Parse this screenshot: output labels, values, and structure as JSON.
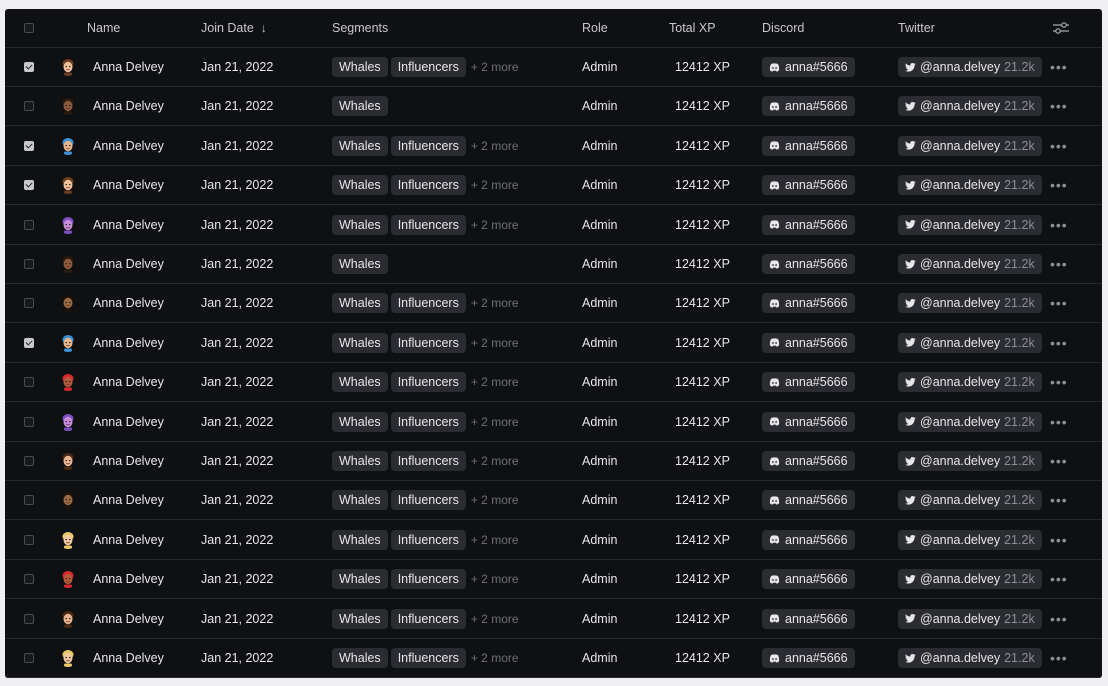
{
  "header": {
    "name": "Name",
    "join_date": "Join Date",
    "sort_glyph": "↓",
    "segments": "Segments",
    "role": "Role",
    "total_xp": "Total XP",
    "discord": "Discord",
    "twitter": "Twitter"
  },
  "rows": [
    {
      "checked": true,
      "avatar": "avatar-1",
      "name": "Anna Delvey",
      "join_date": "Jan 21, 2022",
      "segments": [
        "Whales",
        "Influencers"
      ],
      "more": "+ 2 more",
      "role": "Admin",
      "xp": "12412 XP",
      "discord": "anna#5666",
      "twitter": "@anna.delvey",
      "followers": "21.2k"
    },
    {
      "checked": false,
      "avatar": "avatar-2",
      "name": "Anna Delvey",
      "join_date": "Jan 21, 2022",
      "segments": [
        "Whales"
      ],
      "more": "",
      "role": "Admin",
      "xp": "12412 XP",
      "discord": "anna#5666",
      "twitter": "@anna.delvey",
      "followers": "21.2k"
    },
    {
      "checked": true,
      "avatar": "avatar-3",
      "name": "Anna Delvey",
      "join_date": "Jan 21, 2022",
      "segments": [
        "Whales",
        "Influencers"
      ],
      "more": "+ 2 more",
      "role": "Admin",
      "xp": "12412 XP",
      "discord": "anna#5666",
      "twitter": "@anna.delvey",
      "followers": "21.2k"
    },
    {
      "checked": true,
      "avatar": "avatar-1",
      "name": "Anna Delvey",
      "join_date": "Jan 21, 2022",
      "segments": [
        "Whales",
        "Influencers"
      ],
      "more": "+ 2 more",
      "role": "Admin",
      "xp": "12412 XP",
      "discord": "anna#5666",
      "twitter": "@anna.delvey",
      "followers": "21.2k"
    },
    {
      "checked": false,
      "avatar": "avatar-4",
      "name": "Anna Delvey",
      "join_date": "Jan 21, 2022",
      "segments": [
        "Whales",
        "Influencers"
      ],
      "more": "+ 2 more",
      "role": "Admin",
      "xp": "12412 XP",
      "discord": "anna#5666",
      "twitter": "@anna.delvey",
      "followers": "21.2k"
    },
    {
      "checked": false,
      "avatar": "avatar-2",
      "name": "Anna Delvey",
      "join_date": "Jan 21, 2022",
      "segments": [
        "Whales"
      ],
      "more": "",
      "role": "Admin",
      "xp": "12412 XP",
      "discord": "anna#5666",
      "twitter": "@anna.delvey",
      "followers": "21.2k"
    },
    {
      "checked": false,
      "avatar": "avatar-5",
      "name": "Anna Delvey",
      "join_date": "Jan 21, 2022",
      "segments": [
        "Whales",
        "Influencers"
      ],
      "more": "+ 2 more",
      "role": "Admin",
      "xp": "12412 XP",
      "discord": "anna#5666",
      "twitter": "@anna.delvey",
      "followers": "21.2k"
    },
    {
      "checked": true,
      "avatar": "avatar-3",
      "name": "Anna Delvey",
      "join_date": "Jan 21, 2022",
      "segments": [
        "Whales",
        "Influencers"
      ],
      "more": "+ 2 more",
      "role": "Admin",
      "xp": "12412 XP",
      "discord": "anna#5666",
      "twitter": "@anna.delvey",
      "followers": "21.2k"
    },
    {
      "checked": false,
      "avatar": "avatar-6",
      "name": "Anna Delvey",
      "join_date": "Jan 21, 2022",
      "segments": [
        "Whales",
        "Influencers"
      ],
      "more": "+ 2 more",
      "role": "Admin",
      "xp": "12412 XP",
      "discord": "anna#5666",
      "twitter": "@anna.delvey",
      "followers": "21.2k"
    },
    {
      "checked": false,
      "avatar": "avatar-4",
      "name": "Anna Delvey",
      "join_date": "Jan 21, 2022",
      "segments": [
        "Whales",
        "Influencers"
      ],
      "more": "+ 2 more",
      "role": "Admin",
      "xp": "12412 XP",
      "discord": "anna#5666",
      "twitter": "@anna.delvey",
      "followers": "21.2k"
    },
    {
      "checked": false,
      "avatar": "avatar-7",
      "name": "Anna Delvey",
      "join_date": "Jan 21, 2022",
      "segments": [
        "Whales",
        "Influencers"
      ],
      "more": "+ 2 more",
      "role": "Admin",
      "xp": "12412 XP",
      "discord": "anna#5666",
      "twitter": "@anna.delvey",
      "followers": "21.2k"
    },
    {
      "checked": false,
      "avatar": "avatar-5",
      "name": "Anna Delvey",
      "join_date": "Jan 21, 2022",
      "segments": [
        "Whales",
        "Influencers"
      ],
      "more": "+ 2 more",
      "role": "Admin",
      "xp": "12412 XP",
      "discord": "anna#5666",
      "twitter": "@anna.delvey",
      "followers": "21.2k"
    },
    {
      "checked": false,
      "avatar": "avatar-8",
      "name": "Anna Delvey",
      "join_date": "Jan 21, 2022",
      "segments": [
        "Whales",
        "Influencers"
      ],
      "more": "+ 2 more",
      "role": "Admin",
      "xp": "12412 XP",
      "discord": "anna#5666",
      "twitter": "@anna.delvey",
      "followers": "21.2k"
    },
    {
      "checked": false,
      "avatar": "avatar-6",
      "name": "Anna Delvey",
      "join_date": "Jan 21, 2022",
      "segments": [
        "Whales",
        "Influencers"
      ],
      "more": "+ 2 more",
      "role": "Admin",
      "xp": "12412 XP",
      "discord": "anna#5666",
      "twitter": "@anna.delvey",
      "followers": "21.2k"
    },
    {
      "checked": false,
      "avatar": "avatar-7",
      "name": "Anna Delvey",
      "join_date": "Jan 21, 2022",
      "segments": [
        "Whales",
        "Influencers"
      ],
      "more": "+ 2 more",
      "role": "Admin",
      "xp": "12412 XP",
      "discord": "anna#5666",
      "twitter": "@anna.delvey",
      "followers": "21.2k"
    },
    {
      "checked": false,
      "avatar": "avatar-8",
      "name": "Anna Delvey",
      "join_date": "Jan 21, 2022",
      "segments": [
        "Whales",
        "Influencers"
      ],
      "more": "+ 2 more",
      "role": "Admin",
      "xp": "12412 XP",
      "discord": "anna#5666",
      "twitter": "@anna.delvey",
      "followers": "21.2k"
    }
  ],
  "avatar_colors": {
    "avatar-1": {
      "skin": "#f2c09a",
      "hair": "#6b3d1f"
    },
    "avatar-2": {
      "skin": "#8d5a3b",
      "hair": "#2a1a10"
    },
    "avatar-3": {
      "skin": "#e8b48c",
      "hair": "#3d8fd8"
    },
    "avatar-4": {
      "skin": "#c88cd8",
      "hair": "#7b4fc0"
    },
    "avatar-5": {
      "skin": "#9a6a44",
      "hair": "#1c130c"
    },
    "avatar-6": {
      "skin": "#b55a3a",
      "hair": "#d8282e"
    },
    "avatar-7": {
      "skin": "#e9b590",
      "hair": "#4a2a14"
    },
    "avatar-8": {
      "skin": "#f1c8a0",
      "hair": "#e8c864"
    }
  },
  "colors": {
    "background": "#0f1012",
    "pill": "#2b2c31",
    "divider": "#26272b",
    "text": "#e7e7ea",
    "muted": "#6f7076"
  }
}
